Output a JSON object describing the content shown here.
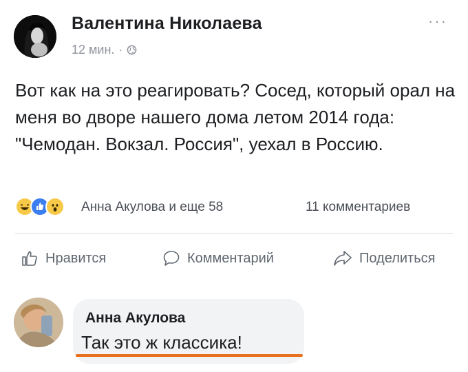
{
  "post": {
    "author": "Валентина Николаева",
    "time": "12 мин.",
    "separator": "·",
    "more": "···",
    "text": "Вот как на это реагировать? Сосед, который орал на меня во дворе нашего дома летом 2014 года: \"Чемодан. Вокзал. Россия\", уехал в Россию.",
    "privacy_icon": "globe-icon"
  },
  "reactions": {
    "icons": [
      "haha-reaction-icon",
      "like-reaction-icon",
      "wow-reaction-icon"
    ],
    "names": "Анна Акулова и еще 58",
    "comments_count": "11 комментариев"
  },
  "actions": {
    "like": "Нравится",
    "comment": "Комментарий",
    "share": "Поделиться"
  },
  "comment": {
    "author": "Анна Акулова",
    "text": "Так это ж классика!"
  },
  "colors": {
    "accent_underline": "#e8701f",
    "like_blue": "#3b7ef0",
    "muted_text": "#90949c"
  }
}
